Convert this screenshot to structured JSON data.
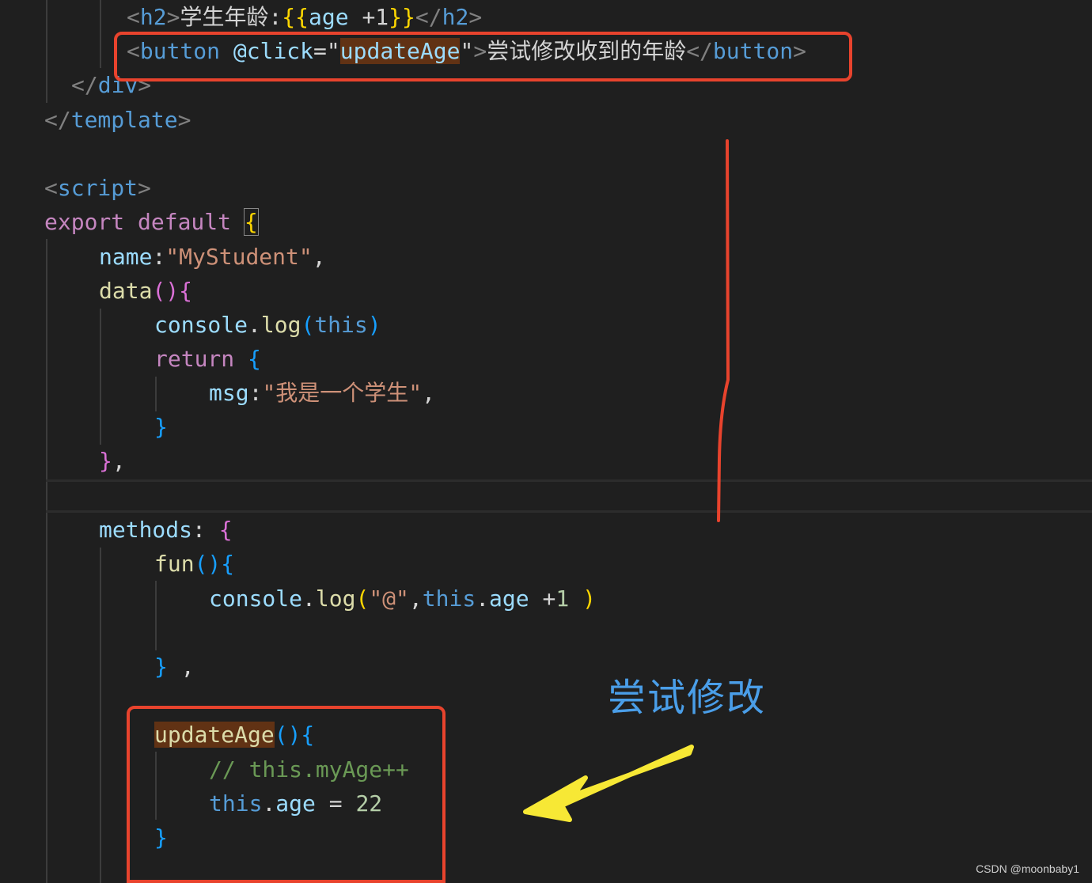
{
  "code_lines": [
    {
      "tokens": [
        {
          "t": "<",
          "c": "punct"
        },
        {
          "t": "h2",
          "c": "tag"
        },
        {
          "t": ">",
          "c": "punct"
        },
        {
          "t": "学生年龄:",
          "c": "text"
        },
        {
          "t": "{{",
          "c": "brace-gold"
        },
        {
          "t": "age ",
          "c": "attr"
        },
        {
          "t": "+1",
          "c": "text"
        },
        {
          "t": "}}",
          "c": "brace-gold"
        },
        {
          "t": "</",
          "c": "punct"
        },
        {
          "t": "h2",
          "c": "tag"
        },
        {
          "t": ">",
          "c": "punct"
        }
      ]
    },
    {
      "tokens": [
        {
          "t": "<",
          "c": "punct"
        },
        {
          "t": "button",
          "c": "tag"
        },
        {
          "t": " ",
          "c": "text"
        },
        {
          "t": "@click",
          "c": "attr"
        },
        {
          "t": "=\"",
          "c": "text"
        },
        {
          "t": "updateAge",
          "c": "attr",
          "hl": true
        },
        {
          "t": "\"",
          "c": "text"
        },
        {
          "t": ">",
          "c": "punct"
        },
        {
          "t": "尝试修改收到的年龄",
          "c": "text"
        },
        {
          "t": "</",
          "c": "punct"
        },
        {
          "t": "button",
          "c": "tag"
        },
        {
          "t": ">",
          "c": "punct"
        }
      ]
    },
    {
      "tokens": [
        {
          "t": "</",
          "c": "punct"
        },
        {
          "t": "div",
          "c": "tag"
        },
        {
          "t": ">",
          "c": "punct"
        }
      ]
    },
    {
      "tokens": [
        {
          "t": "</",
          "c": "punct"
        },
        {
          "t": "template",
          "c": "tag"
        },
        {
          "t": ">",
          "c": "punct"
        }
      ]
    },
    {
      "tokens": []
    },
    {
      "tokens": [
        {
          "t": "<",
          "c": "punct"
        },
        {
          "t": "script",
          "c": "tag"
        },
        {
          "t": ">",
          "c": "punct"
        }
      ]
    },
    {
      "tokens": [
        {
          "t": "export default ",
          "c": "keyword"
        },
        {
          "t": "{",
          "c": "brace-gold",
          "match": true
        }
      ]
    },
    {
      "tokens": [
        {
          "t": "name",
          "c": "attr"
        },
        {
          "t": ":",
          "c": "text"
        },
        {
          "t": "\"MyStudent\"",
          "c": "string"
        },
        {
          "t": ",",
          "c": "text"
        }
      ]
    },
    {
      "tokens": [
        {
          "t": "data",
          "c": "func"
        },
        {
          "t": "(){",
          "c": "brace-purple"
        }
      ]
    },
    {
      "tokens": [
        {
          "t": "console",
          "c": "attr"
        },
        {
          "t": ".",
          "c": "text"
        },
        {
          "t": "log",
          "c": "func"
        },
        {
          "t": "(",
          "c": "brace-blue"
        },
        {
          "t": "this",
          "c": "this"
        },
        {
          "t": ")",
          "c": "brace-blue"
        }
      ]
    },
    {
      "tokens": [
        {
          "t": "return ",
          "c": "keyword"
        },
        {
          "t": "{",
          "c": "brace-blue"
        }
      ]
    },
    {
      "tokens": [
        {
          "t": "msg",
          "c": "attr"
        },
        {
          "t": ":",
          "c": "text"
        },
        {
          "t": "\"我是一个学生\"",
          "c": "string"
        },
        {
          "t": ",",
          "c": "text"
        }
      ]
    },
    {
      "tokens": [
        {
          "t": "}",
          "c": "brace-blue"
        }
      ]
    },
    {
      "tokens": [
        {
          "t": "}",
          "c": "brace-purple"
        },
        {
          "t": ",",
          "c": "text"
        }
      ]
    },
    {
      "tokens": []
    },
    {
      "tokens": [
        {
          "t": "methods",
          "c": "attr"
        },
        {
          "t": ": ",
          "c": "text"
        },
        {
          "t": "{",
          "c": "brace-purple"
        }
      ]
    },
    {
      "tokens": [
        {
          "t": "fun",
          "c": "func"
        },
        {
          "t": "(){",
          "c": "brace-blue"
        }
      ]
    },
    {
      "tokens": [
        {
          "t": "console",
          "c": "attr"
        },
        {
          "t": ".",
          "c": "text"
        },
        {
          "t": "log",
          "c": "func"
        },
        {
          "t": "(",
          "c": "brace-gold"
        },
        {
          "t": "\"@\"",
          "c": "string"
        },
        {
          "t": ",",
          "c": "text"
        },
        {
          "t": "this",
          "c": "this"
        },
        {
          "t": ".",
          "c": "text"
        },
        {
          "t": "age",
          "c": "attr"
        },
        {
          "t": " +",
          "c": "text"
        },
        {
          "t": "1",
          "c": "number"
        },
        {
          "t": " ",
          "c": "text"
        },
        {
          "t": ")",
          "c": "brace-gold"
        }
      ]
    },
    {
      "tokens": []
    },
    {
      "tokens": [
        {
          "t": "}",
          "c": "brace-blue"
        },
        {
          "t": " ,",
          "c": "text"
        }
      ]
    },
    {
      "tokens": []
    },
    {
      "tokens": [
        {
          "t": "updateAge",
          "c": "func",
          "hl": true
        },
        {
          "t": "(){",
          "c": "brace-blue"
        }
      ]
    },
    {
      "tokens": [
        {
          "t": "// this.myAge++",
          "c": "comment"
        }
      ]
    },
    {
      "tokens": [
        {
          "t": "this",
          "c": "this"
        },
        {
          "t": ".",
          "c": "text"
        },
        {
          "t": "age",
          "c": "attr"
        },
        {
          "t": " = ",
          "c": "text"
        },
        {
          "t": "22",
          "c": "number"
        }
      ]
    },
    {
      "tokens": [
        {
          "t": "}",
          "c": "brace-blue"
        }
      ]
    }
  ],
  "annotation": {
    "label": "尝试修改",
    "box_color": "#e8432d",
    "arrow_color": "#f7e835",
    "label_color": "#4a9ee8"
  },
  "watermark": "CSDN @moonbaby1",
  "colors": {
    "background": "#1f1f1f",
    "tag": "#569cd6",
    "keyword": "#c586c0",
    "attribute": "#9cdcfe",
    "string": "#ce9178",
    "function": "#dcdcaa",
    "comment": "#6a9955",
    "number": "#b5cea8"
  }
}
